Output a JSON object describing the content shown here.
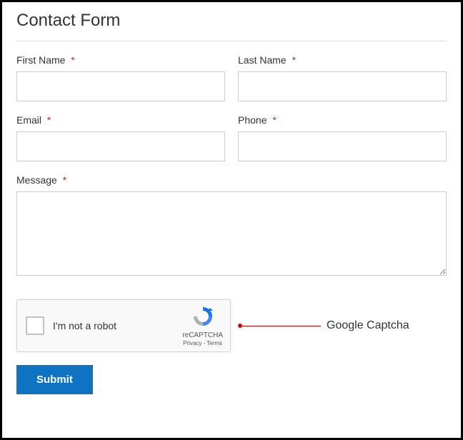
{
  "form": {
    "title": "Contact Form",
    "fields": {
      "first_name": {
        "label": "First Name",
        "required_marker": "*",
        "value": ""
      },
      "last_name": {
        "label": "Last Name",
        "required_marker": "*",
        "value": ""
      },
      "email": {
        "label": "Email",
        "required_marker": "*",
        "value": ""
      },
      "phone": {
        "label": "Phone",
        "required_marker": "*",
        "value": ""
      },
      "message": {
        "label": "Message",
        "required_marker": "*",
        "value": ""
      }
    },
    "recaptcha": {
      "checkbox_label": "I'm not a robot",
      "brand": "reCAPTCHA",
      "links": "Privacy - Terms"
    },
    "submit_label": "Submit"
  },
  "annotation": {
    "label": "Google Captcha"
  }
}
